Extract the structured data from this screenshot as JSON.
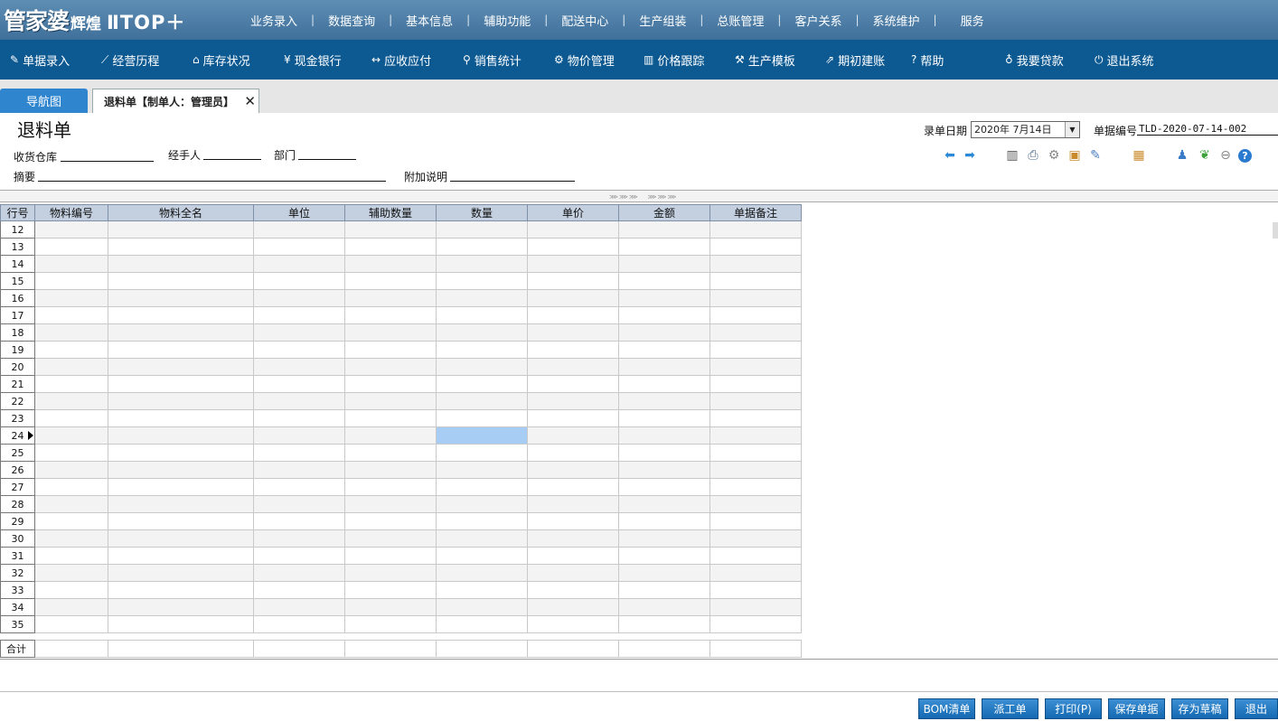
{
  "logo": {
    "part1": "管家婆",
    "part2": "辉煌",
    "part3": "ⅡTOP＋"
  },
  "top_menu": [
    "业务录入",
    "数据查询",
    "基本信息",
    "辅助功能",
    "配送中心",
    "生产组装",
    "总账管理",
    "客户关系",
    "系统维护",
    "服务"
  ],
  "toolbar": {
    "items": [
      {
        "icon": "document-edit-icon",
        "label": "单据录入"
      },
      {
        "icon": "line-chart-icon",
        "label": "经营历程"
      },
      {
        "icon": "home-icon",
        "label": "库存状况"
      },
      {
        "icon": "yen-icon",
        "label": "现金银行"
      },
      {
        "icon": "swap-arrows-icon",
        "label": "应收应付"
      },
      {
        "icon": "search-icon",
        "label": "销售统计"
      },
      {
        "icon": "gear-icon",
        "label": "物价管理"
      },
      {
        "icon": "bar-chart-icon",
        "label": "价格跟踪"
      },
      {
        "icon": "wrench-icon",
        "label": "生产模板"
      },
      {
        "icon": "external-link-icon",
        "label": "期初建账"
      },
      {
        "icon": "help-icon",
        "label": "帮助"
      },
      {
        "icon": "money-bag-icon",
        "label": "我要贷款"
      },
      {
        "icon": "power-icon",
        "label": "退出系统"
      }
    ]
  },
  "tabs": {
    "nav": "导航图",
    "doc": "退料单【制单人：管理员】"
  },
  "form": {
    "title": "退料单",
    "date_label": "录单日期",
    "date_value": "2020年 7月14日",
    "docno_label": "单据编号",
    "docno_value": "TLD-2020-07-14-002",
    "warehouse_label": "收货仓库",
    "handler_label": "经手人",
    "dept_label": "部门",
    "summary_label": "摘要",
    "note_label": "附加说明"
  },
  "grid": {
    "columns": [
      "行号",
      "物料编号",
      "物料全名",
      "单位",
      "辅助数量",
      "数量",
      "单价",
      "金额",
      "单据备注"
    ],
    "row_numbers": [
      "12",
      "13",
      "14",
      "15",
      "16",
      "17",
      "18",
      "19",
      "20",
      "21",
      "22",
      "23",
      "24",
      "25",
      "26",
      "27",
      "28",
      "29",
      "30",
      "31",
      "32",
      "33",
      "34",
      "35"
    ],
    "selected_row": "24",
    "selected_column": "数量",
    "total_label": "合计"
  },
  "buttons": [
    "BOM清单",
    "派工单",
    "打印(P)",
    "保存单据",
    "存为草稿",
    "退出"
  ]
}
